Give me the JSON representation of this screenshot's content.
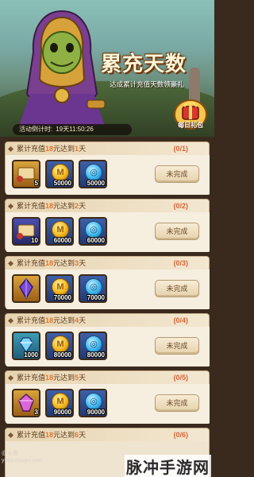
{
  "banner": {
    "title": "累充天数",
    "subtitle": "达成累计充值天数领豪礼",
    "timer_label": "活动倒计时:",
    "timer_value": "19天11:50:26",
    "gift_label": "每日礼包"
  },
  "tasks": [
    {
      "prefix": "累计充值",
      "amount": "18",
      "mid": "元达到",
      "days": "1",
      "suffix": "天",
      "progress": "(0/1)",
      "rewards": [
        {
          "icon": "scroll-icon",
          "qty": "5"
        },
        {
          "icon": "gold-coin-icon",
          "qty": "50000"
        },
        {
          "icon": "blue-coin-icon",
          "qty": "50000"
        }
      ],
      "button": "未完成"
    },
    {
      "prefix": "累计充值",
      "amount": "18",
      "mid": "元达到",
      "days": "2",
      "suffix": "天",
      "progress": "(0/2)",
      "rewards": [
        {
          "icon": "scroll-icon",
          "qty": "10"
        },
        {
          "icon": "gold-coin-icon",
          "qty": "60000"
        },
        {
          "icon": "blue-coin-icon",
          "qty": "60000"
        }
      ],
      "button": "未完成"
    },
    {
      "prefix": "累计充值",
      "amount": "18",
      "mid": "元达到",
      "days": "3",
      "suffix": "天",
      "progress": "(0/3)",
      "rewards": [
        {
          "icon": "purple-crystal-icon",
          "qty": ""
        },
        {
          "icon": "gold-coin-icon",
          "qty": "70000"
        },
        {
          "icon": "blue-coin-icon",
          "qty": "70000"
        }
      ],
      "button": "未完成"
    },
    {
      "prefix": "累计充值",
      "amount": "18",
      "mid": "元达到",
      "days": "4",
      "suffix": "天",
      "progress": "(0/4)",
      "rewards": [
        {
          "icon": "diamond-icon",
          "qty": "1000"
        },
        {
          "icon": "gold-coin-icon",
          "qty": "80000"
        },
        {
          "icon": "blue-coin-icon",
          "qty": "80000"
        }
      ],
      "button": "未完成"
    },
    {
      "prefix": "累计充值",
      "amount": "18",
      "mid": "元达到",
      "days": "5",
      "suffix": "天",
      "progress": "(0/5)",
      "rewards": [
        {
          "icon": "pink-gem-icon",
          "qty": "3"
        },
        {
          "icon": "gold-coin-icon",
          "qty": "90000"
        },
        {
          "icon": "blue-coin-icon",
          "qty": "90000"
        }
      ],
      "button": "未完成"
    },
    {
      "prefix": "累计充值",
      "amount": "18",
      "mid": "元达到",
      "days": "6",
      "suffix": "天",
      "progress": "(0/6)",
      "rewards": [],
      "button": ""
    }
  ],
  "watermark": {
    "site_line1": "@斗鱼",
    "site_line2": "yuba.douyu.com",
    "brand": "脉冲手游网"
  },
  "colors": {
    "highlight": "#e8742a",
    "progress": "#d4663b",
    "card_bg": "#efe4cf"
  }
}
